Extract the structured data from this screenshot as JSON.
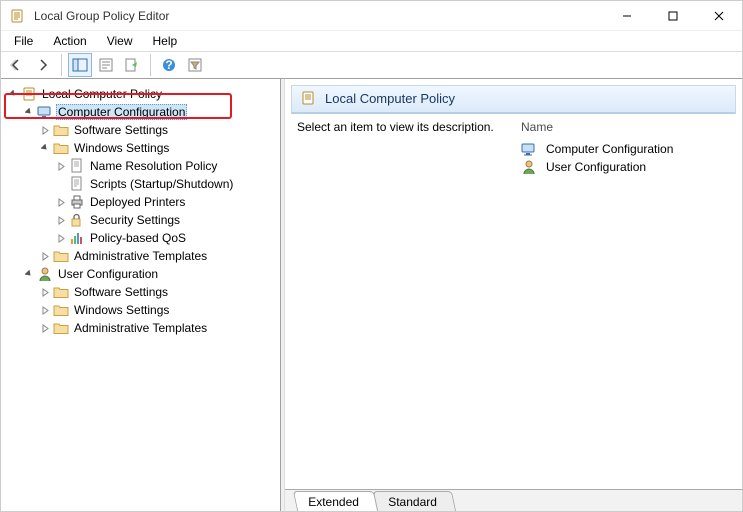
{
  "window": {
    "title": "Local Group Policy Editor"
  },
  "menu": {
    "file": "File",
    "action": "Action",
    "view": "View",
    "help": "Help"
  },
  "tree": {
    "root": "Local Computer Policy",
    "computer_config": "Computer Configuration",
    "software_settings": "Software Settings",
    "windows_settings": "Windows Settings",
    "name_resolution": "Name Resolution Policy",
    "scripts": "Scripts (Startup/Shutdown)",
    "deployed_printers": "Deployed Printers",
    "security_settings": "Security Settings",
    "policy_qos": "Policy-based QoS",
    "admin_templates": "Administrative Templates",
    "user_config": "User Configuration",
    "u_software": "Software Settings",
    "u_windows": "Windows Settings",
    "u_admin": "Administrative Templates"
  },
  "details": {
    "header": "Local Computer Policy",
    "description": "Select an item to view its description.",
    "name_col": "Name",
    "items": {
      "cc": "Computer Configuration",
      "uc": "User Configuration"
    }
  },
  "tabs": {
    "extended": "Extended",
    "standard": "Standard"
  }
}
